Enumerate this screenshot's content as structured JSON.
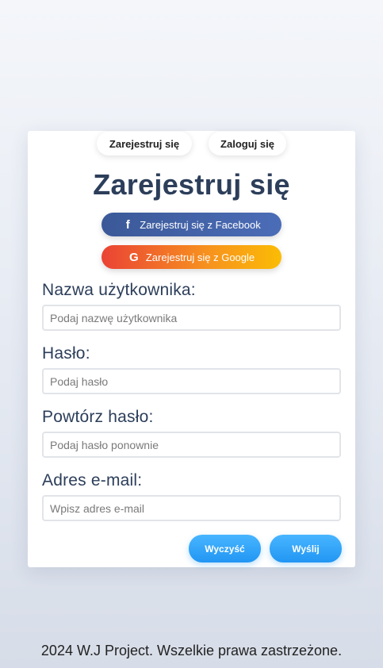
{
  "tabs": {
    "register": "Zarejestruj się",
    "login": "Zaloguj się"
  },
  "title": "Zarejestruj się",
  "social": {
    "facebook": {
      "icon": "facebook-icon",
      "glyph": "f",
      "label": "Zarejestruj się z Facebook"
    },
    "google": {
      "icon": "google-icon",
      "glyph": "G",
      "label": "Zarejestruj się z Google"
    }
  },
  "form": {
    "username": {
      "label": "Nazwa użytkownika:",
      "placeholder": "Podaj nazwę użytkownika",
      "value": ""
    },
    "password": {
      "label": "Hasło:",
      "placeholder": "Podaj hasło",
      "value": ""
    },
    "password_repeat": {
      "label": "Powtórz hasło:",
      "placeholder": "Podaj hasło ponownie",
      "value": ""
    },
    "email": {
      "label": "Adres e-mail:",
      "placeholder": "Wpisz adres e-mail",
      "value": ""
    }
  },
  "actions": {
    "clear": "Wyczyść",
    "submit": "Wyślij"
  },
  "footer": "2024 W.J Project. Wszelkie prawa zastrzeżone.",
  "colors": {
    "title": "#2c3e5a",
    "facebook": "#3b5998",
    "google_start": "#ea4335",
    "google_end": "#fbbc05",
    "action": "#2196f3"
  }
}
